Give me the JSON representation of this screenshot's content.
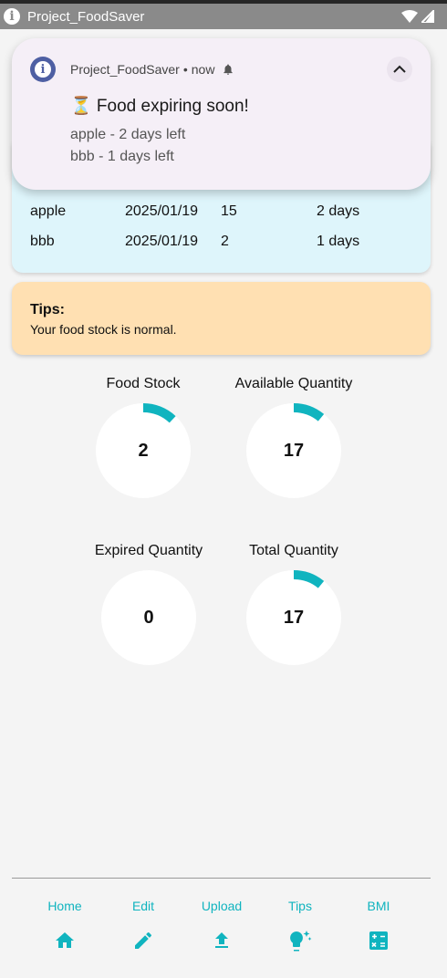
{
  "status_bar": {
    "app_name": "Project_FoodSaver"
  },
  "expiring_table": {
    "rows": [
      {
        "name": "apple",
        "date": "2025/01/19",
        "qty": "15",
        "left": "2 days"
      },
      {
        "name": "bbb",
        "date": "2025/01/19",
        "qty": "2",
        "left": "1 days"
      }
    ]
  },
  "tips": {
    "title": "Tips:",
    "text": "Your food stock is normal."
  },
  "stats": [
    {
      "label": "Food Stock",
      "value": "2",
      "fraction": 0.12
    },
    {
      "label": "Available Quantity",
      "value": "17",
      "fraction": 0.11
    },
    {
      "label": "Expired Quantity",
      "value": "0",
      "fraction": 0
    },
    {
      "label": "Total Quantity",
      "value": "17",
      "fraction": 0.11
    }
  ],
  "nav": [
    {
      "label": "Home",
      "icon": "home-icon"
    },
    {
      "label": "Edit",
      "icon": "pencil-icon"
    },
    {
      "label": "Upload",
      "icon": "upload-icon"
    },
    {
      "label": "Tips",
      "icon": "lightbulb-icon"
    },
    {
      "label": "BMI",
      "icon": "calculator-icon"
    }
  ],
  "notification": {
    "app": "Project_FoodSaver",
    "time": "now",
    "title": "⏳ Food expiring soon!",
    "lines": [
      "apple - 2 days left",
      "bbb - 1 days left"
    ]
  },
  "colors": {
    "accent": "#10b4bf",
    "tips_bg": "#ffe0b2",
    "table_bg": "#def5fb",
    "notif_icon": "#4e5fa3"
  }
}
